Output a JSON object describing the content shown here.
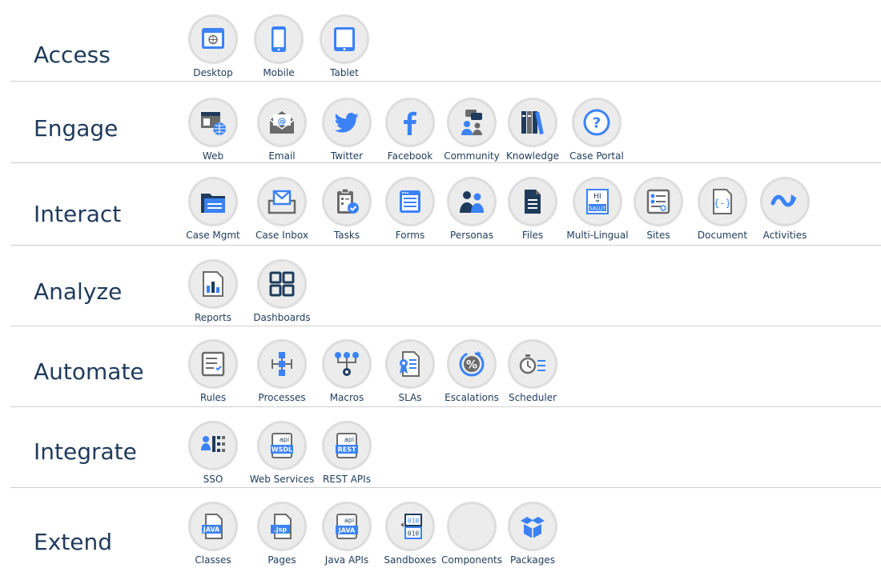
{
  "rows": [
    {
      "category": "Access",
      "items": [
        {
          "label": "Desktop",
          "icon": "desktop-icon"
        },
        {
          "label": "Mobile",
          "icon": "mobile-icon"
        },
        {
          "label": "Tablet",
          "icon": "tablet-icon"
        }
      ]
    },
    {
      "category": "Engage",
      "items": [
        {
          "label": "Web",
          "icon": "web-icon"
        },
        {
          "label": "Email",
          "icon": "email-icon"
        },
        {
          "label": "Twitter",
          "icon": "twitter-icon"
        },
        {
          "label": "Facebook",
          "icon": "facebook-icon"
        },
        {
          "label": "Community",
          "icon": "community-icon"
        },
        {
          "label": "Knowledge",
          "icon": "knowledge-icon"
        },
        {
          "label": "Case Portal",
          "icon": "case-portal-icon"
        }
      ]
    },
    {
      "category": "Interact",
      "items": [
        {
          "label": "Case Mgmt",
          "icon": "folder-icon"
        },
        {
          "label": "Case Inbox",
          "icon": "inbox-icon"
        },
        {
          "label": "Tasks",
          "icon": "clipboard-check-icon"
        },
        {
          "label": "Forms",
          "icon": "form-icon"
        },
        {
          "label": "Personas",
          "icon": "personas-icon"
        },
        {
          "label": "Files",
          "icon": "file-icon"
        },
        {
          "label": "Multi-Lingual",
          "icon": "multi-lingual-icon",
          "text": [
            "HI",
            "SALUT"
          ]
        },
        {
          "label": "Sites",
          "icon": "sites-icon"
        },
        {
          "label": "Document",
          "icon": "document-icon"
        },
        {
          "label": "Activities",
          "icon": "activities-icon"
        }
      ]
    },
    {
      "category": "Analyze",
      "items": [
        {
          "label": "Reports",
          "icon": "report-icon"
        },
        {
          "label": "Dashboards",
          "icon": "dashboard-icon"
        }
      ]
    },
    {
      "category": "Automate",
      "items": [
        {
          "label": "Rules",
          "icon": "rules-icon"
        },
        {
          "label": "Processes",
          "icon": "process-icon"
        },
        {
          "label": "Macros",
          "icon": "macros-icon"
        },
        {
          "label": "SLAs",
          "icon": "sla-icon"
        },
        {
          "label": "Escalations",
          "icon": "escalation-icon"
        },
        {
          "label": "Scheduler",
          "icon": "scheduler-icon"
        }
      ]
    },
    {
      "category": "Integrate",
      "items": [
        {
          "label": "SSO",
          "icon": "sso-icon"
        },
        {
          "label": "Web Services",
          "icon": "wsdl-icon",
          "text": [
            "api",
            "WSDL"
          ]
        },
        {
          "label": "REST APIs",
          "icon": "rest-icon",
          "text": [
            "api",
            "REST"
          ]
        }
      ]
    },
    {
      "category": "Extend",
      "items": [
        {
          "label": "Classes",
          "icon": "java-file-icon",
          "text": [
            "JAVA"
          ]
        },
        {
          "label": "Pages",
          "icon": "jsp-file-icon",
          "text": [
            ".jsp"
          ]
        },
        {
          "label": "Java APIs",
          "icon": "java-api-icon",
          "text": [
            "api",
            "JAVA"
          ]
        },
        {
          "label": "Sandboxes",
          "icon": "sandbox-icon",
          "text": [
            "010",
            "010"
          ]
        },
        {
          "label": "Components",
          "icon": "code-icon",
          "text": [
            "</>"
          ]
        },
        {
          "label": "Packages",
          "icon": "package-icon"
        }
      ]
    }
  ],
  "colors": {
    "accent": "#3b82f6",
    "dark": "#1f3b5c",
    "gray": "#6b6b6b",
    "badge": "#ececec"
  }
}
